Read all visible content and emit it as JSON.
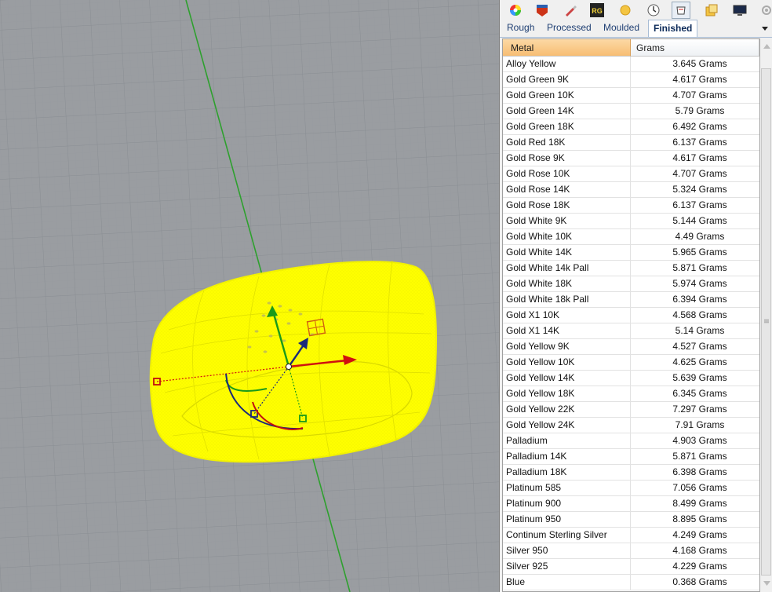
{
  "viewport": {
    "grid_color": "#8d9196",
    "background_color": "#9a9da1",
    "axis_color": "#2ea02e",
    "object_color": "#ffff00"
  },
  "toolbar": {
    "icons": [
      {
        "name": "color-wheel-icon"
      },
      {
        "name": "material-icon"
      },
      {
        "name": "brush-icon"
      },
      {
        "name": "rg-logo-icon",
        "label": "RG"
      },
      {
        "name": "gem-icon"
      },
      {
        "name": "clock-icon"
      },
      {
        "name": "ring-weight-icon"
      },
      {
        "name": "layers-icon"
      },
      {
        "name": "display-icon"
      },
      {
        "name": "settings-icon"
      }
    ]
  },
  "tabs": [
    {
      "label": "Rough"
    },
    {
      "label": "Processed"
    },
    {
      "label": "Moulded"
    },
    {
      "label": "Finished"
    }
  ],
  "active_tab": "Finished",
  "table": {
    "columns": {
      "metal": "Metal",
      "grams": "Grams"
    },
    "rows": [
      {
        "metal": "Alloy Yellow",
        "grams": "3.645 Grams"
      },
      {
        "metal": "Gold Green 9K",
        "grams": "4.617 Grams"
      },
      {
        "metal": "Gold Green 10K",
        "grams": "4.707 Grams"
      },
      {
        "metal": "Gold Green 14K",
        "grams": "5.79 Grams"
      },
      {
        "metal": "Gold Green 18K",
        "grams": "6.492 Grams"
      },
      {
        "metal": "Gold Red 18K",
        "grams": "6.137 Grams"
      },
      {
        "metal": "Gold Rose 9K",
        "grams": "4.617 Grams"
      },
      {
        "metal": "Gold Rose 10K",
        "grams": "4.707 Grams"
      },
      {
        "metal": "Gold Rose 14K",
        "grams": "5.324 Grams"
      },
      {
        "metal": "Gold Rose 18K",
        "grams": "6.137 Grams"
      },
      {
        "metal": "Gold White 9K",
        "grams": "5.144 Grams"
      },
      {
        "metal": "Gold White 10K",
        "grams": "4.49 Grams"
      },
      {
        "metal": "Gold White 14K",
        "grams": "5.965 Grams"
      },
      {
        "metal": "Gold White 14k Pall",
        "grams": "5.871 Grams"
      },
      {
        "metal": "Gold White 18K",
        "grams": "5.974 Grams"
      },
      {
        "metal": "Gold White 18k Pall",
        "grams": "6.394 Grams"
      },
      {
        "metal": "Gold X1 10K",
        "grams": "4.568 Grams"
      },
      {
        "metal": "Gold X1 14K",
        "grams": "5.14 Grams"
      },
      {
        "metal": "Gold Yellow 9K",
        "grams": "4.527 Grams"
      },
      {
        "metal": "Gold Yellow 10K",
        "grams": "4.625 Grams"
      },
      {
        "metal": "Gold Yellow 14K",
        "grams": "5.639 Grams"
      },
      {
        "metal": "Gold Yellow 18K",
        "grams": "6.345 Grams"
      },
      {
        "metal": "Gold Yellow 22K",
        "grams": "7.297 Grams"
      },
      {
        "metal": "Gold Yellow 24K",
        "grams": "7.91 Grams"
      },
      {
        "metal": "Palladium",
        "grams": "4.903 Grams"
      },
      {
        "metal": "Palladium 14K",
        "grams": "5.871 Grams"
      },
      {
        "metal": "Palladium 18K",
        "grams": "6.398 Grams"
      },
      {
        "metal": "Platinum 585",
        "grams": "7.056 Grams"
      },
      {
        "metal": "Platinum 900",
        "grams": "8.499 Grams"
      },
      {
        "metal": "Platinum 950",
        "grams": "8.895 Grams"
      },
      {
        "metal": "Continum Sterling Silver",
        "grams": "4.249 Grams"
      },
      {
        "metal": "Silver 950",
        "grams": "4.168 Grams"
      },
      {
        "metal": "Silver 925",
        "grams": "4.229 Grams"
      },
      {
        "metal": "Blue",
        "grams": "0.368 Grams"
      }
    ]
  },
  "colors": {
    "header_sort_gradient_top": "#fcd9a5",
    "header_sort_gradient_bottom": "#f7bd73",
    "tab_text": "#1f3f73"
  }
}
